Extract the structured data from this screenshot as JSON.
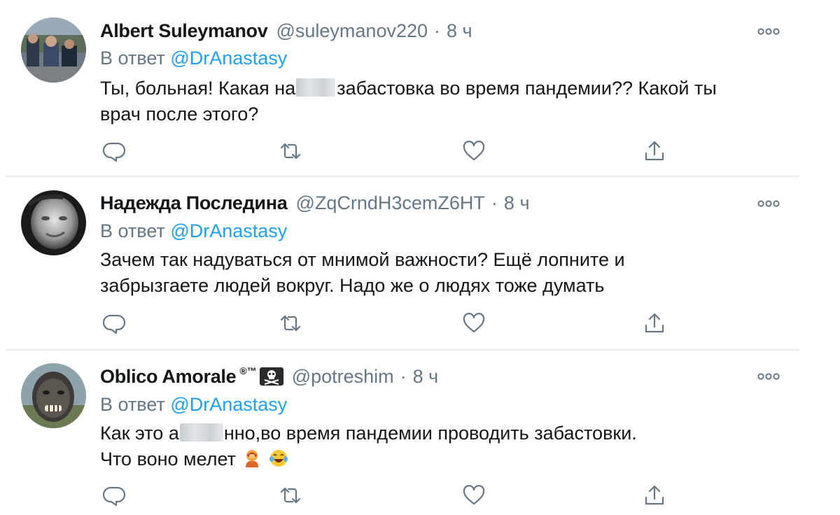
{
  "reply_prefix": "В ответ",
  "tweets": [
    {
      "name": "Albert Suleymanov",
      "handle": "@suleymanov220",
      "separator": "·",
      "time": "8 ч",
      "reply_to": "@DrAnastasy",
      "lines": [
        {
          "a": "Ты, больная! Какая на",
          "b": "забастовка во время пандемии?? Какой ты"
        },
        {
          "a": "врач после этого?",
          "b": ""
        }
      ],
      "avatar_icon": "photo-avatar"
    },
    {
      "name": "Надежда Последина",
      "handle": "@ZqCrndH3cemZ6HT",
      "separator": "·",
      "time": "8 ч",
      "reply_to": "@DrAnastasy",
      "lines": [
        "Зачем так надуваться от мнимой важности? Ещё лопните и",
        "забрызгаете людей вокруг. Надо же о людях тоже думать"
      ],
      "avatar_icon": "photo-avatar"
    },
    {
      "name": "Oblico Amorale",
      "name_badge": "®™",
      "name_emoji": "skull-crossbones-flag-icon",
      "handle": "@potreshim",
      "separator": "·",
      "time": "8 ч",
      "reply_to": "@DrAnastasy",
      "lines": [
        {
          "a": "Как это а",
          "b": "нно,во время пандемии проводить забастовки."
        },
        {
          "a": "Что воно мелет",
          "b": ""
        }
      ],
      "line2_emojis": [
        "facepalm-emoji",
        "tears-of-joy-emoji"
      ],
      "avatar_icon": "photo-avatar"
    }
  ],
  "action_icons": [
    "reply-icon",
    "retweet-icon",
    "like-icon",
    "share-icon"
  ],
  "colors": {
    "text": "#14171a",
    "secondary": "#657786",
    "link": "#1da1f2",
    "divider": "#e6ecf0"
  }
}
